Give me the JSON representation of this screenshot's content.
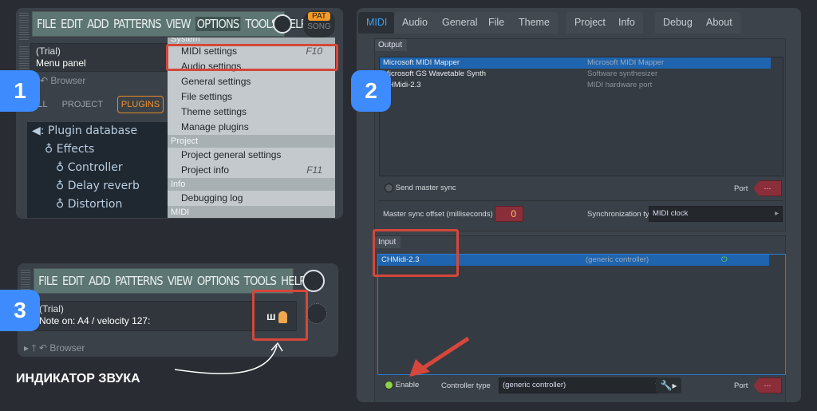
{
  "badges": [
    "1",
    "2",
    "3"
  ],
  "panel1": {
    "menu": [
      "FILE",
      "EDIT",
      "ADD",
      "PATTERNS",
      "VIEW",
      "OPTIONS",
      "TOOLS",
      "HELP"
    ],
    "pat": "PAT",
    "song": "SONG",
    "hint_line1": "(Trial)",
    "hint_line2": "Menu panel",
    "browser": "Browser",
    "browser_tabs": [
      "ALL",
      "PROJECT",
      "PLUGINS"
    ],
    "tree": [
      "Plugin database",
      "Effects",
      "Controller",
      "Delay reverb",
      "Distortion"
    ],
    "dropdown": {
      "section_system": "System",
      "items_system": [
        {
          "label": "MIDI settings",
          "shortcut": "F10"
        },
        {
          "label": "Audio settings"
        },
        {
          "label": "General settings"
        },
        {
          "label": "File settings"
        },
        {
          "label": "Theme settings"
        },
        {
          "label": "Manage plugins"
        }
      ],
      "section_project": "Project",
      "items_project": [
        {
          "label": "Project general settings"
        },
        {
          "label": "Project info",
          "shortcut": "F11"
        }
      ],
      "section_info": "Info",
      "items_info": [
        {
          "label": "Debugging log"
        }
      ],
      "section_midi": "MIDI"
    }
  },
  "panel2": {
    "tabs": [
      "MIDI",
      "Audio",
      "General",
      "File",
      "Theme",
      "Project",
      "Info",
      "Debug",
      "About"
    ],
    "output": {
      "title": "Output",
      "rows": [
        {
          "name": "Microsoft MIDI Mapper",
          "desc": "Microsoft MIDI Mapper",
          "selected": true
        },
        {
          "name": "Microsoft GS Wavetable Synth",
          "desc": "Software synthesizer"
        },
        {
          "name": "CHMidi-2.3",
          "desc": "MIDI hardware port"
        }
      ]
    },
    "send_master_sync": "Send master sync",
    "port_label": "Port",
    "port_value": "---",
    "offset_label": "Master sync offset (milliseconds)",
    "offset_value": "0",
    "sync_type_label": "Synchronization type",
    "sync_type_value": "MIDI clock",
    "input": {
      "title": "Input",
      "rows": [
        {
          "name": "CHMidi-2.3",
          "desc": "(generic controller)",
          "selected": true,
          "enabled": true
        }
      ]
    },
    "enable_label": "Enable",
    "controller_type_label": "Controller type",
    "controller_type_value": "(generic controller)"
  },
  "panel3": {
    "menu": [
      "FILE",
      "EDIT",
      "ADD",
      "PATTERNS",
      "VIEW",
      "OPTIONS",
      "TOOLS",
      "HELP"
    ],
    "hint_line1": "(Trial)",
    "hint_line2": "Note on: A4 / velocity 127:",
    "browser": "Browser"
  },
  "caption": "ИНДИКАТОР ЗВУКА",
  "colors": {
    "accent": "#3d8bfd",
    "highlight": "#d5473b",
    "selection": "#1f64ae"
  }
}
